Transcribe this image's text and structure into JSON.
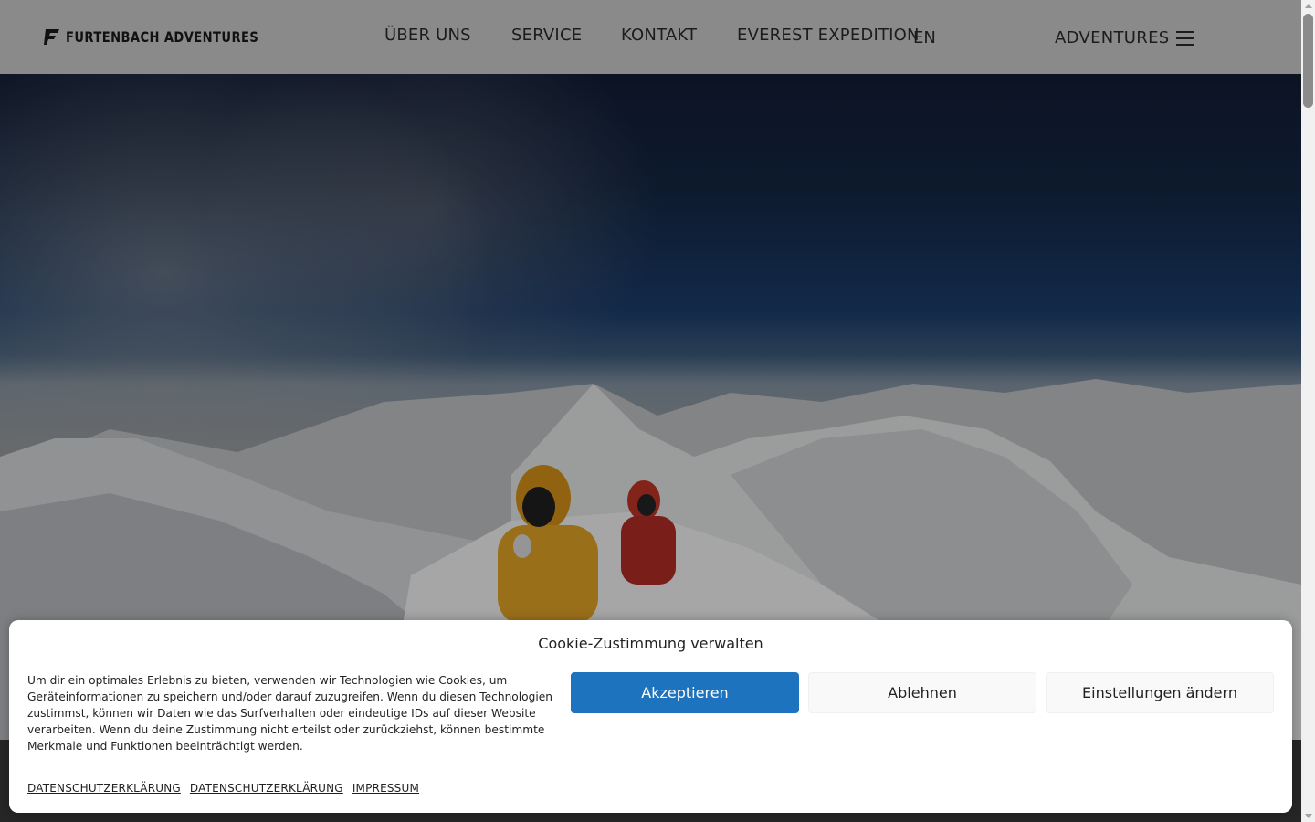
{
  "header": {
    "logo_text": "FURTENBACH ADVENTURES",
    "nav": [
      {
        "label": "ÜBER UNS"
      },
      {
        "label": "SERVICE"
      },
      {
        "label": "KONTAKT"
      },
      {
        "label": "EVEREST EXPEDITION"
      }
    ],
    "language": "EN",
    "adventures_label": "ADVENTURES",
    "menu_icon": "hamburger-menu-icon"
  },
  "cookie_banner": {
    "title": "Cookie-Zustimmung verwalten",
    "text": "Um dir ein optimales Erlebnis zu bieten, verwenden wir Technologien wie Cookies, um Geräteinformationen zu speichern und/oder darauf zuzugreifen. Wenn du diesen Technologien zustimmst, können wir Daten wie das Surfverhalten oder eindeutige IDs auf dieser Website verarbeiten. Wenn du deine Zustimmung nicht erteilst oder zurückziehst, können bestimmte Merkmale und Funktionen beeinträchtigt werden.",
    "accept_label": "Akzeptieren",
    "deny_label": "Ablehnen",
    "settings_label": "Einstellungen ändern",
    "links": [
      "DATENSCHUTZERKLÄRUNG",
      "DATENSCHUTZERKLÄRUNG",
      "IMPRESSUM"
    ]
  },
  "colors": {
    "accent": "#1e73be",
    "header_bg": "#8a8a8a",
    "text": "#1c1c1c"
  }
}
